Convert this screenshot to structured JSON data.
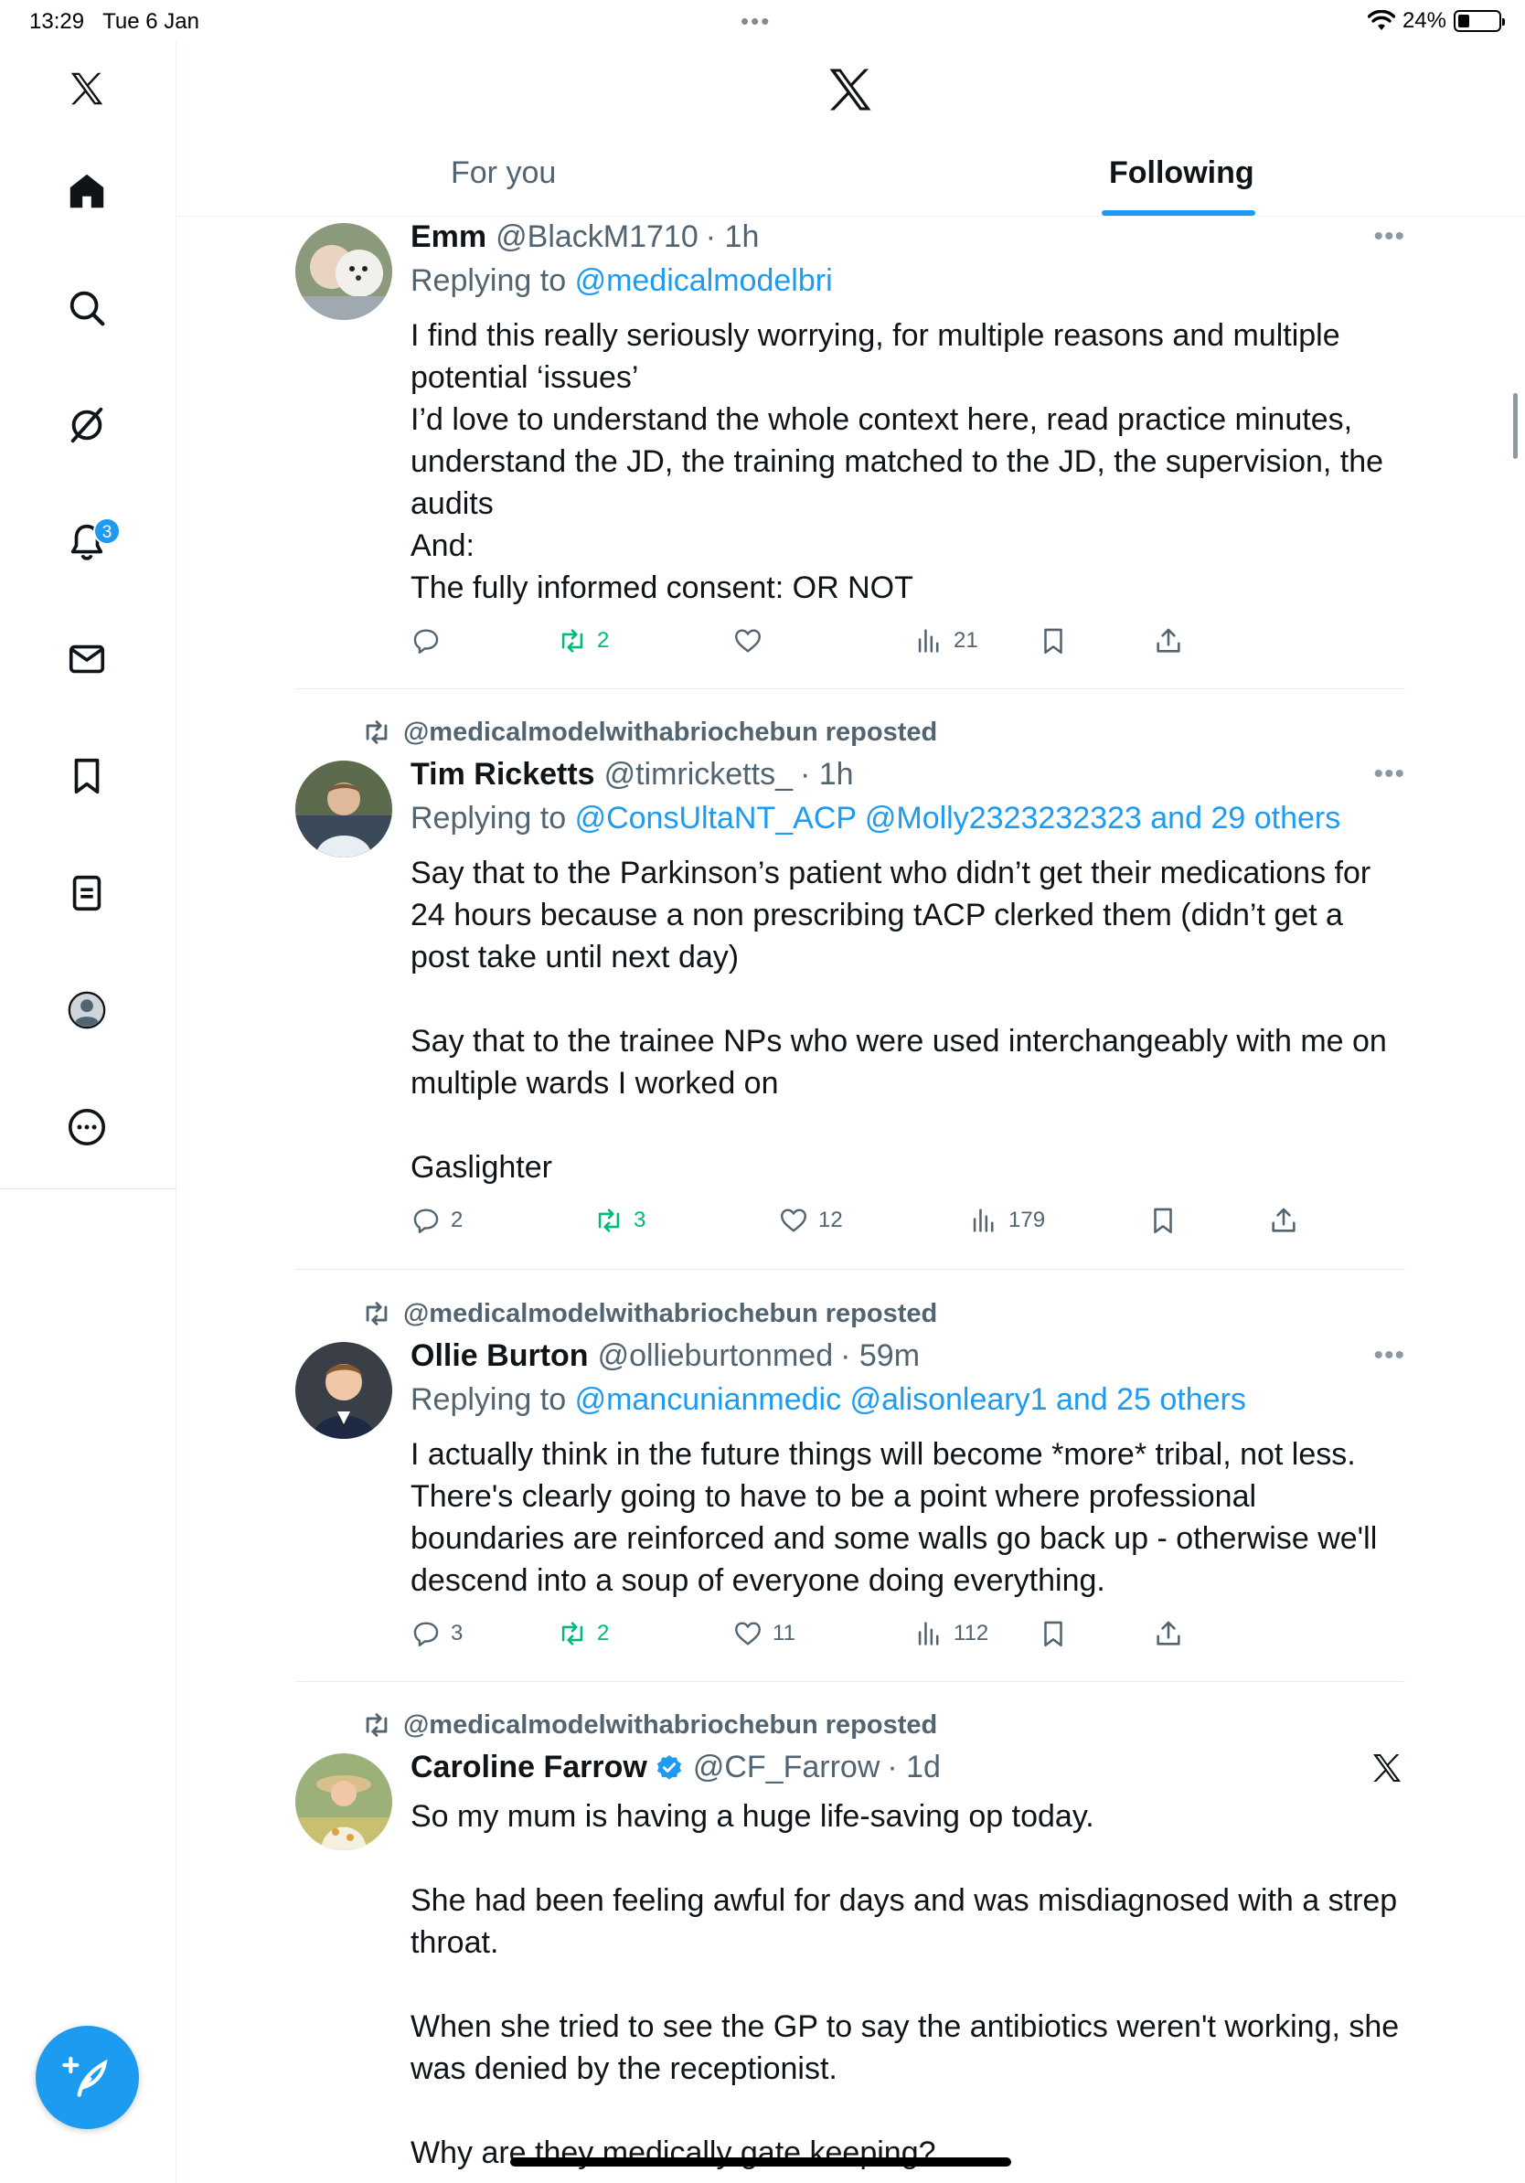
{
  "status": {
    "time": "13:29",
    "date": "Tue 6 Jan",
    "battery": "24%",
    "battery_level": 0.24
  },
  "sidebar": {
    "notifications_badge": "3"
  },
  "tabs": {
    "for_you": "For you",
    "following": "Following"
  },
  "tweets": [
    {
      "name": "Emm",
      "handle": "@BlackM1710",
      "time": "· 1h",
      "replying_label": "Replying to",
      "replying_to": "@medicalmodelbri",
      "body": "I find this really seriously worrying, for multiple reasons and multiple potential ‘issues’\nI’d love to understand the whole context here, read practice minutes, understand the JD, the training matched to the JD, the supervision, the audits\nAnd:\nThe fully informed consent: OR NOT",
      "replies": "",
      "reposts": "2",
      "likes": "",
      "views": "21"
    },
    {
      "reposted_by": "@medicalmodelwithabriochebun reposted",
      "name": "Tim Ricketts",
      "handle": "@timricketts_",
      "time": "· 1h",
      "replying_label": "Replying to",
      "replying_to": "@ConsUltaNT_ACP @Molly2323232323 and 29 others",
      "body": "Say that to the Parkinson’s patient who didn’t get their medications for 24 hours because a non prescribing tACP clerked them (didn’t get a post take until next day)\n\nSay that to the trainee NPs who were used interchangeably with me on multiple wards I worked on\n\nGaslighter",
      "replies": "2",
      "reposts": "3",
      "likes": "12",
      "views": "179"
    },
    {
      "reposted_by": "@medicalmodelwithabriochebun reposted",
      "name": "Ollie Burton",
      "handle": "@ollieburtonmed",
      "time": "· 59m",
      "replying_label": "Replying to",
      "replying_to": "@mancunianmedic @alisonleary1 and 25 others",
      "body": "I actually think in the future things will become *more* tribal, not less. There's clearly going to have to be a point where professional boundaries are reinforced and some walls go back up - otherwise we'll descend into a soup of everyone doing everything.",
      "replies": "3",
      "reposts": "2",
      "likes": "11",
      "views": "112"
    },
    {
      "reposted_by": "@medicalmodelwithabriochebun reposted",
      "name": "Caroline Farrow",
      "handle": "@CF_Farrow",
      "time": "· 1d",
      "body": "So my mum is having a huge life-saving op today.\n\nShe had been feeling awful for days and was misdiagnosed with a strep throat.\n\nWhen she tried to see the GP to say the antibiotics weren't working, she was denied by the receptionist.\n\nWhy are they medically gate keeping?"
    }
  ]
}
